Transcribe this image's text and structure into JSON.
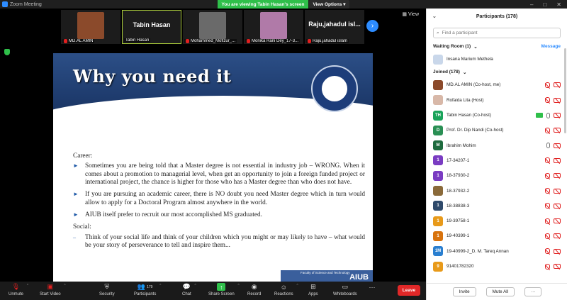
{
  "window": {
    "title": "Zoom Meeting"
  },
  "banner": {
    "viewing": "You are viewing Tabin Hasan's screen",
    "view_options": "View Options ▾"
  },
  "meeting": {
    "view_label": "View",
    "thumbnails": [
      {
        "label": "MD.AL AMIN",
        "muted": true,
        "kind": "photo",
        "color": "#8b4a2b"
      },
      {
        "label": "Tabin Hasan",
        "muted": false,
        "kind": "name",
        "bigname": "Tabin Hasan",
        "active": true
      },
      {
        "label": "Mohammed_Mofizur_...",
        "muted": true,
        "kind": "photo",
        "color": "#6a6a6a"
      },
      {
        "label": "Monika Rani Dey_17-3...",
        "muted": true,
        "kind": "photo",
        "color": "#b07aa8"
      },
      {
        "label": "Raju,jahadul islam",
        "muted": true,
        "kind": "name",
        "bigname": "Raju,jahadul isl..."
      }
    ]
  },
  "slide": {
    "title": "Why you need it",
    "seal_top": "AMERICAN INTERNATIONAL UNIVERSITY",
    "seal_bottom": "BANGLADESH",
    "seal_year": "1994",
    "career_heading": "Career:",
    "career_bullets": [
      "Sometimes you are being told that a Master degree is not essential in industry job – WRONG. When it comes about a promotion to managerial level, when get an opportunity to join a foreign funded project or international project, the chance is higher for those who has a Master degree than who does not have.",
      "If you are pursuing an academic career, there is NO doubt you need Master degree which in turn would allow to apply for a Doctoral Program almost anywhere in the world.",
      "AIUB itself prefer to recruit our most accomplished MS graduated."
    ],
    "social_heading": "Social:",
    "social_bullets": [
      "Think of your social life and think of your children which you might or may likely to have – what would be your story of perseverance to tell and inspire them..."
    ],
    "footer_faculty": "Faculty of Science and Technology",
    "footer_brand": "AIUB"
  },
  "toolbar": {
    "unmute": "Unmute",
    "start_video": "Start Video",
    "security": "Security",
    "participants": "Participants",
    "participants_count": "179",
    "chat": "Chat",
    "share_screen": "Share Screen",
    "record": "Record",
    "reactions": "Reactions",
    "apps": "Apps",
    "whiteboards": "Whiteboards",
    "leave": "Leave"
  },
  "panel": {
    "title": "Participants (178)",
    "search_placeholder": "Find a participant",
    "waiting_room": "Waiting Room (1)",
    "message": "Message",
    "waiting": [
      {
        "name": "Insana Marium Methela",
        "initials": "",
        "color": "#c9d7ea"
      }
    ],
    "joined": "Joined (178)",
    "participants": [
      {
        "name": "MD.AL AMIN (Co-host, me)",
        "initials": "",
        "color": "#8b4a2b",
        "mic": "off",
        "cam": "off"
      },
      {
        "name": "Rofaida Lita (Host)",
        "initials": "",
        "color": "#d8b8a8",
        "mic": "off",
        "cam": "off"
      },
      {
        "name": "Tabin Hasan (Co-host)",
        "initials": "TH",
        "color": "#1aa35a",
        "mic": "on",
        "cam": "off",
        "sharing": true
      },
      {
        "name": "Prof. Dr. Dip Nandi (Co-host)",
        "initials": "D",
        "color": "#2a8f54",
        "mic": "off",
        "cam": "off"
      },
      {
        "name": "Ibrahim Mohim",
        "initials": "M",
        "color": "#1e6b3e",
        "mic": "on",
        "cam": "off"
      },
      {
        "name": "17-34207-1",
        "initials": "1",
        "color": "#7a3cc2",
        "mic": "off",
        "cam": "off"
      },
      {
        "name": "18-37930-2",
        "initials": "1",
        "color": "#7a3cc2",
        "mic": "off",
        "cam": "off"
      },
      {
        "name": "18-37932-2",
        "initials": "",
        "color": "#8a6a3a",
        "mic": "off",
        "cam": "off"
      },
      {
        "name": "18-38838-3",
        "initials": "1",
        "color": "#2f4a6b",
        "mic": "off",
        "cam": "off"
      },
      {
        "name": "19-39758-1",
        "initials": "1",
        "color": "#e89a1a",
        "mic": "off",
        "cam": "off"
      },
      {
        "name": "19-40399-1",
        "initials": "1",
        "color": "#d8730e",
        "mic": "off",
        "cam": "off"
      },
      {
        "name": "19-40999-2_D. M. Tareq Annan",
        "initials": "1M",
        "color": "#2a7fd0",
        "mic": "off",
        "cam": "off"
      },
      {
        "name": "91401782320",
        "initials": "9",
        "color": "#e89a1a",
        "mic": "off",
        "cam": "off"
      }
    ],
    "footer": {
      "invite": "Invite",
      "mute_all": "Mute All",
      "more": "···"
    }
  }
}
